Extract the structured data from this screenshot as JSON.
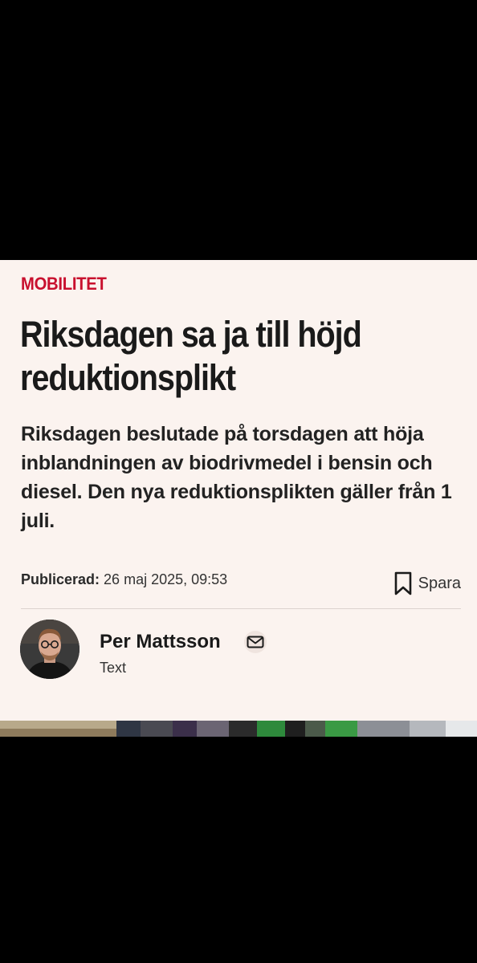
{
  "article": {
    "kicker": "MOBILITET",
    "headline": "Riksdagen sa ja till höjd reduktionsplikt",
    "lead": "Riksdagen beslutade på torsdagen att höja inblandningen av biodrivmedel i bensin och diesel. Den nya reduktionsplikten gäller från 1 juli.",
    "published_label": "Publicerad:",
    "published_value": "26 maj 2025, 09:53",
    "save_label": "Spara"
  },
  "author": {
    "name": "Per Mattsson",
    "role": "Text"
  },
  "icons": {
    "save": "bookmark-icon",
    "mail": "mail-icon"
  },
  "colors": {
    "kicker": "#c8102e",
    "card_background": "#fbf3ef",
    "outer_background": "#000000"
  }
}
